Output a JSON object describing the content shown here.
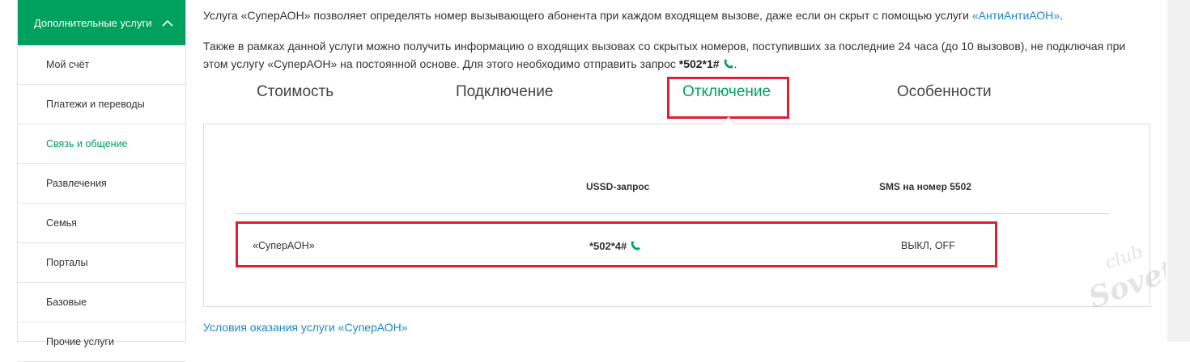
{
  "sidebar": {
    "header": "Дополнительные услуги",
    "items": [
      {
        "label": "Мой счёт",
        "active": false
      },
      {
        "label": "Платежи и переводы",
        "active": false
      },
      {
        "label": "Связь и общение",
        "active": true
      },
      {
        "label": "Развлечения",
        "active": false
      },
      {
        "label": "Семья",
        "active": false
      },
      {
        "label": "Порталы",
        "active": false
      },
      {
        "label": "Базовые",
        "active": false
      },
      {
        "label": "Прочие услуги",
        "active": false
      }
    ]
  },
  "intro": {
    "p1_text": "Услуга «СуперАОН» позволяет определять номер вызывающего абонента при каждом входящем вызове, даже если он скрыт с помощью услуги ",
    "p1_link": "«АнтиАнтиАОН»",
    "p1_end": ".",
    "p2_text": "Также в рамках данной услуги можно получить информацию о входящих вызовах со скрытых номеров, поступивших за последние 24 часа (до 10 вызовов), не подключая при этом услугу «СуперАОН» на постоянной основе. Для этого необходимо отправить запрос ",
    "p2_code": "*502*1#",
    "p2_end": "."
  },
  "tabs": [
    "Стоимость",
    "Подключение",
    "Отключение",
    "Особенности"
  ],
  "active_tab": "Отключение",
  "table": {
    "headers": [
      "USSD-запрос",
      "SMS на номер 5502"
    ],
    "rows": [
      {
        "name": "«СуперАОН»",
        "ussd": "*502*4#",
        "sms": "ВЫКЛ, OFF"
      }
    ]
  },
  "footer_link": "Условия оказания услуги «СуперАОН»",
  "watermark": "club Sovet",
  "colors": {
    "accent": "#00a15f",
    "link": "#1e88c7",
    "highlight": "#e0202e"
  }
}
